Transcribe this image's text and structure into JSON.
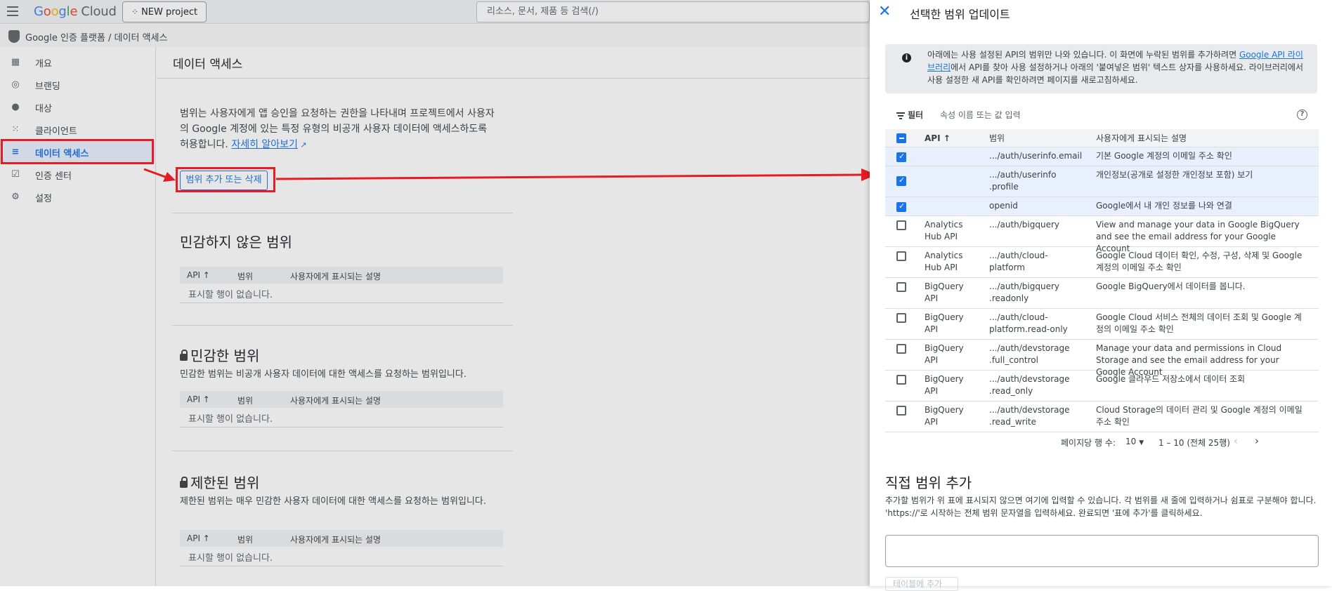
{
  "header": {
    "logo": "Google Cloud",
    "project_button": "NEW project",
    "search_placeholder": "리소스, 문서, 제품 등 검색(/)"
  },
  "breadcrumb": "Google 인증 플랫폼  /  데이터 액세스",
  "sidebar": {
    "items": [
      {
        "label": "개요",
        "icon": "dashboard-icon"
      },
      {
        "label": "브랜딩",
        "icon": "palette-icon"
      },
      {
        "label": "대상",
        "icon": "person-icon"
      },
      {
        "label": "클라이언트",
        "icon": "grid-icon"
      },
      {
        "label": "데이터 액세스",
        "icon": "data-access-icon",
        "active": true
      },
      {
        "label": "인증 센터",
        "icon": "verified-icon"
      },
      {
        "label": "설정",
        "icon": "gear-icon"
      }
    ]
  },
  "main": {
    "title": "데이터 액세스",
    "intro": "범위는 사용자에게 앱 승인을 요청하는 권한을 나타내며 프로젝트에서 사용자의 Google 계정에 있는 특정 유형의 비공개 사용자 데이터에 액세스하도록 허용합니다. ",
    "learn_more": "자세히 알아보기",
    "scope_button": "범위 추가 또는 삭제",
    "non_sensitive": {
      "title": "민감하지 않은 범위"
    },
    "sensitive": {
      "title": "민감한 범위",
      "desc": "민감한 범위는 비공개 사용자 데이터에 대한 액세스를 요청하는 범위입니다."
    },
    "restricted": {
      "title": "제한된 범위",
      "desc": "제한된 범위는 매우 민감한 사용자 데이터에 대한 액세스를 요청하는 범위입니다."
    },
    "table_headers": {
      "api": "API ↑",
      "scope": "범위",
      "desc": "사용자에게 표시되는 설명"
    },
    "empty_text": "표시할 행이 없습니다."
  },
  "panel": {
    "title": "선택한 범위 업데이트",
    "info_text_1": "아래에는 사용 설정된 API의 범위만 나와 있습니다. 이 화면에 누락된 범위를 추가하려면 ",
    "info_link": "Google API 라이브러리",
    "info_text_2": "에서 API를 찾아 사용 설정하거나 아래의 '붙여넣은 범위' 텍스트 상자를 사용하세요. 라이브러리에서 사용 설정한 새 API를 확인하려면 페이지를 새로고침하세요.",
    "filter_label": "필터",
    "filter_placeholder": "속성 이름 또는 값 입력",
    "headers": {
      "api": "API ↑",
      "scope": "범위",
      "desc": "사용자에게 표시되는 설명"
    },
    "rows": [
      {
        "checked": true,
        "api": "",
        "scope": ".../auth/userinfo.email",
        "desc": "기본 Google 계정의 이메일 주소 확인"
      },
      {
        "checked": true,
        "api": "",
        "scope": ".../auth/userinfo .profile",
        "desc": "개인정보(공개로 설정한 개인정보 포함) 보기"
      },
      {
        "checked": true,
        "api": "",
        "scope": "openid",
        "desc": "Google에서 내 개인 정보를 나와 연결"
      },
      {
        "checked": false,
        "api": "Analytics Hub API",
        "scope": ".../auth/bigquery",
        "desc": "View and manage your data in Google BigQuery and see the email address for your Google Account"
      },
      {
        "checked": false,
        "api": "Analytics Hub API",
        "scope": ".../auth/cloud-platform",
        "desc": "Google Cloud 데이터 확인, 수정, 구성, 삭제 및 Google 계정의 이메일 주소 확인"
      },
      {
        "checked": false,
        "api": "BigQuery API",
        "scope": ".../auth/bigquery .readonly",
        "desc": "Google BigQuery에서 데이터를 봅니다."
      },
      {
        "checked": false,
        "api": "BigQuery API",
        "scope": ".../auth/cloud-platform.read-only",
        "desc": "Google Cloud 서비스 전체의 데이터 조회 및 Google 계정의 이메일 주소 확인"
      },
      {
        "checked": false,
        "api": "BigQuery API",
        "scope": ".../auth/devstorage .full_control",
        "desc": "Manage your data and permissions in Cloud Storage and see the email address for your Google Account"
      },
      {
        "checked": false,
        "api": "BigQuery API",
        "scope": ".../auth/devstorage .read_only",
        "desc": "Google 클라우드 저장소에서 데이터 조회"
      },
      {
        "checked": false,
        "api": "BigQuery API",
        "scope": ".../auth/devstorage .read_write",
        "desc": "Cloud Storage의 데이터 관리 및 Google 계정의 이메일 주소 확인"
      }
    ],
    "pager": {
      "rows_per_page_label": "페이지당 행 수:",
      "rows_per_page": "10",
      "range": "1 – 10 (전체 25행)"
    },
    "manual_title": "직접 범위 추가",
    "manual_desc": "추가할 범위가 위 표에 표시되지 않으면 여기에 입력할 수 있습니다. 각 범위를 새 줄에 입력하거나 쉼표로 구분해야 합니다. 'https://'로 시작하는 전체 범위 문자열을 입력하세요. 완료되면 '표에 추가'를 클릭하세요.",
    "add_button": "테이블에 추가"
  },
  "colors": {
    "accent": "#1a73e8",
    "annotation_red": "#e51c23",
    "selected_row": "#e8f0fe"
  }
}
